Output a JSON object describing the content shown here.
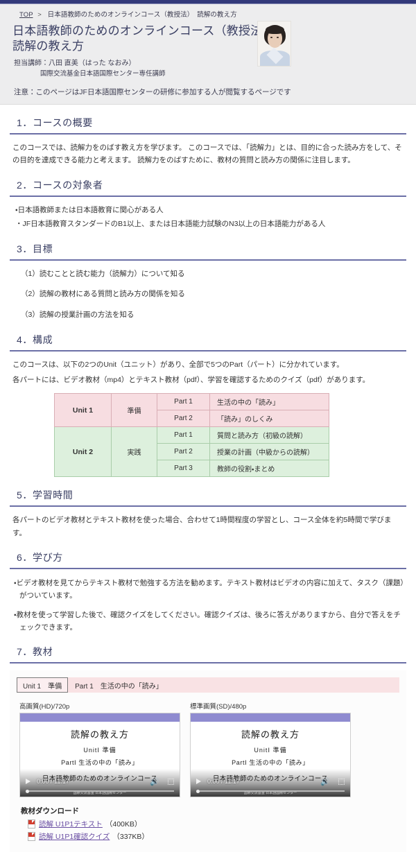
{
  "breadcrumb": {
    "home": "TOP",
    "separator": ">",
    "current": "日本語教師のためのオンラインコース（教授法）　読解の教え方"
  },
  "header": {
    "title_line1": "日本語教師のためのオンラインコース（教授法）",
    "title_line2": "読解の教え方",
    "instructor": "担当講師：八田 直美（はった なおみ）",
    "instructor_affiliation": "国際交流基金日本語国際センター専任講師",
    "notice": "注意：このページはJF日本語国際センターの研修に参加する人が閲覧するページです"
  },
  "sections": {
    "s1": {
      "heading": "1．コースの概要",
      "body": "このコースでは、読解力をのばす教え方を学びます。 このコースでは、「読解力」とは、目的に合った読み方をして、その目的を達成できる能力と考えます。 読解力をのばすために、教材の質問と読み方の関係に注目します。"
    },
    "s2": {
      "heading": "2．コースの対象者",
      "bullets": [
        "・日本語教師または日本語教育に関心がある人",
        "・JF日本語教育スタンダードのB1以上、または日本語能力試験のN3以上の日本語能力がある人"
      ]
    },
    "s3": {
      "heading": "3．目標",
      "items": [
        "（1）読むことと読む能力（読解力）について知る",
        "（2）読解の教材にある質問と読み方の関係を知る",
        "（3）読解の授業計画の方法を知る"
      ]
    },
    "s4": {
      "heading": "4．構成",
      "intro1": "このコースは、以下の2つのUnit（ユニット）があり、全部で5つのPart（パート）に分かれています。",
      "intro2": "各パートには、ビデオ教材（mp4）とテキスト教材（pdf）、学習を確認するためのクイズ（pdf）があります。",
      "table": {
        "rows": [
          {
            "unit": "Unit 1",
            "mode": "準備",
            "part": "Part 1",
            "title": "生活の中の「読み」",
            "group": "u1",
            "unit_rowspan": 2
          },
          {
            "unit": "",
            "mode": "",
            "part": "Part 2",
            "title": "「読み」のしくみ",
            "group": "u1",
            "unit_rowspan": 0
          },
          {
            "unit": "Unit 2",
            "mode": "実践",
            "part": "Part 1",
            "title": "質問と読み方（初級の読解）",
            "group": "u2",
            "unit_rowspan": 3
          },
          {
            "unit": "",
            "mode": "",
            "part": "Part 2",
            "title": "授業の計画（中級からの読解）",
            "group": "u2",
            "unit_rowspan": 0
          },
          {
            "unit": "",
            "mode": "",
            "part": "Part 3",
            "title": "教師の役割・まとめ",
            "group": "u2",
            "unit_rowspan": 0
          }
        ]
      }
    },
    "s5": {
      "heading": "5．学習時間",
      "body": "各パートのビデオ教材とテキスト教材を使った場合、合わせて1時間程度の学習とし、コース全体を約5時間で学びます。"
    },
    "s6": {
      "heading": "6．学び方",
      "bullets": [
        "・ビデオ教材を見てからテキスト教材で勉強する方法を勧めます。テキスト教材はビデオの内容に加えて、タスク（課題）がついています。",
        "・教材を使って学習した後で、確認クイズをしてください。確認クイズは、後ろに答えがありますから、自分で答えをチェックできます。"
      ]
    },
    "s7": {
      "heading": "7．教材",
      "part_bar": {
        "unit_chip": "Unit 1　準備",
        "part_label": "Part 1　生活の中の「読み」"
      },
      "players": [
        {
          "quality": "高画質(HD)/720p",
          "slide_title": "読解の教え方",
          "slide_unit": "UnitⅠ 準備",
          "slide_part": "PartⅠ 生活の中の「読み」",
          "overlay_caption": "日本語教師のためのオンラインコース",
          "overlay_org": "国際交流基金 日本語国際センター",
          "time": "0:00 / 11:17",
          "volume_icon": "speaker-icon",
          "fullscreen_icon": "fullscreen-icon",
          "play_icon": "play-icon"
        },
        {
          "quality": "標準画質(SD)/480p",
          "slide_title": "読解の教え方",
          "slide_unit": "UnitⅠ 準備",
          "slide_part": "PartⅠ 生活の中の「読み」",
          "overlay_caption": "日本語教師のためのオンラインコース",
          "overlay_org": "国際交流基金 日本語国際センター",
          "time": "0:00 / 11:17",
          "volume_icon": "speaker-icon",
          "fullscreen_icon": "fullscreen-icon",
          "play_icon": "play-icon"
        }
      ],
      "downloads": {
        "title": "教材ダウンロード",
        "items": [
          {
            "label": "読解 U1P1テキスト",
            "size": "（400KB）",
            "icon": "pdf-icon"
          },
          {
            "label": "読解 U1P1確認クイズ",
            "size": "（337KB）",
            "icon": "pdf-icon"
          }
        ]
      }
    }
  }
}
